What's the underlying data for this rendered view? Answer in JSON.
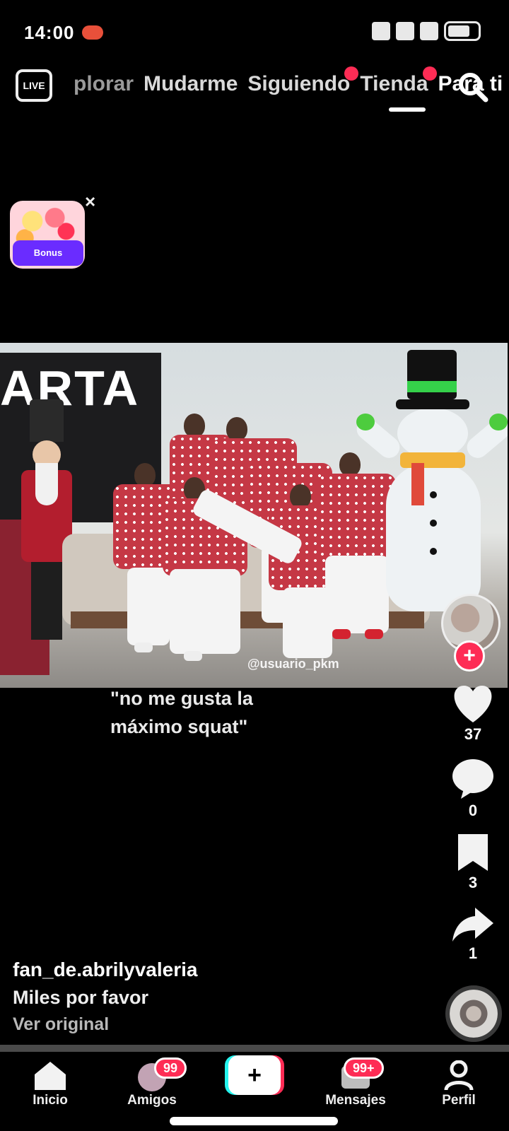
{
  "status_bar": {
    "time": "14:00"
  },
  "top_nav": {
    "live_label": "LIVE",
    "tabs": [
      {
        "label": "plorar",
        "dot": false,
        "active": false
      },
      {
        "label": "Mudarme",
        "dot": false,
        "active": false
      },
      {
        "label": "Siguiendo",
        "dot": true,
        "active": false
      },
      {
        "label": "Tienda",
        "dot": true,
        "active": false
      },
      {
        "label": "Para ti",
        "dot": false,
        "active": true
      }
    ]
  },
  "promo": {
    "label": "Bonus"
  },
  "video": {
    "poster_text": "ARTA",
    "watermark": "@usuario_pkm",
    "overlay_caption": "\"no me gusta la máximo squat\""
  },
  "actions": {
    "likes": "37",
    "comments": "0",
    "saves": "3",
    "shares": "1"
  },
  "post": {
    "username": "fan_de.abrilyvaleria",
    "description": "Miles por favor",
    "see_original": "Ver original"
  },
  "bottom_nav": {
    "home": "Inicio",
    "friends": "Amigos",
    "friends_badge": "99",
    "create": "+",
    "inbox": "Mensajes",
    "inbox_badge": "99+",
    "profile": "Perfil"
  },
  "colors": {
    "accent": "#fe2c55",
    "cyan": "#25f4ee",
    "promo": "#6a2cff"
  }
}
